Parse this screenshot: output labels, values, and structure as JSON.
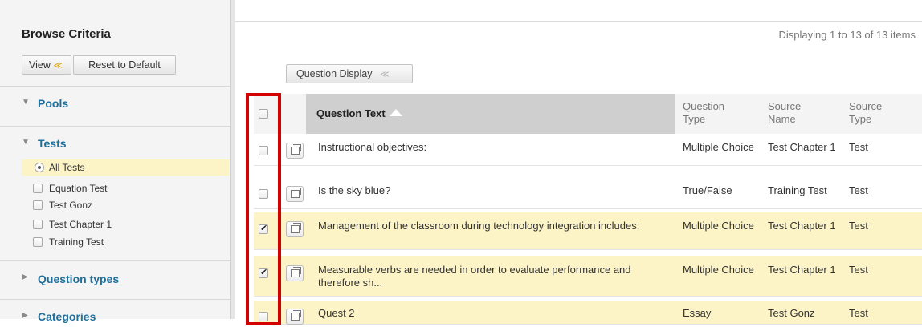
{
  "sidebar": {
    "title": "Browse Criteria",
    "view_label": "View",
    "reset_label": "Reset to Default",
    "sections": {
      "pools": "Pools",
      "tests": "Tests",
      "question_types": "Question types",
      "categories": "Categories"
    },
    "test_options": [
      "All Tests",
      "Equation Test",
      "Test Gonz",
      "Test Chapter 1",
      "Training Test"
    ]
  },
  "main": {
    "displaying": "Displaying 1 to 13 of 13 items",
    "question_display_label": "Question Display",
    "columns": {
      "question_text": "Question Text",
      "question_type": "Question\nType",
      "source_name": "Source\nName",
      "source_type": "Source\nType"
    },
    "rows": [
      {
        "question": "Instructional objectives:",
        "type": "Multiple Choice",
        "source_name": "Test Chapter 1",
        "source_type": "Test",
        "checked": false
      },
      {
        "question": "Is the sky blue?",
        "type": "True/False",
        "source_name": "Training Test",
        "source_type": "Test",
        "checked": false
      },
      {
        "question": "Management of the classroom during technology integration includes:",
        "type": "Multiple Choice",
        "source_name": "Test Chapter 1",
        "source_type": "Test",
        "checked": true
      },
      {
        "question": "Measurable verbs are needed in order to evaluate performance and therefore sh...",
        "type": "Multiple Choice",
        "source_name": "Test Chapter 1",
        "source_type": "Test",
        "checked": true
      },
      {
        "question": "Quest 2",
        "type": "Essay",
        "source_name": "Test Gonz",
        "source_type": "Test",
        "checked": false
      }
    ]
  },
  "colors": {
    "accent_link": "#1f6f9b",
    "highlight": "#fcf3c6",
    "annotation_red": "#d40000"
  }
}
